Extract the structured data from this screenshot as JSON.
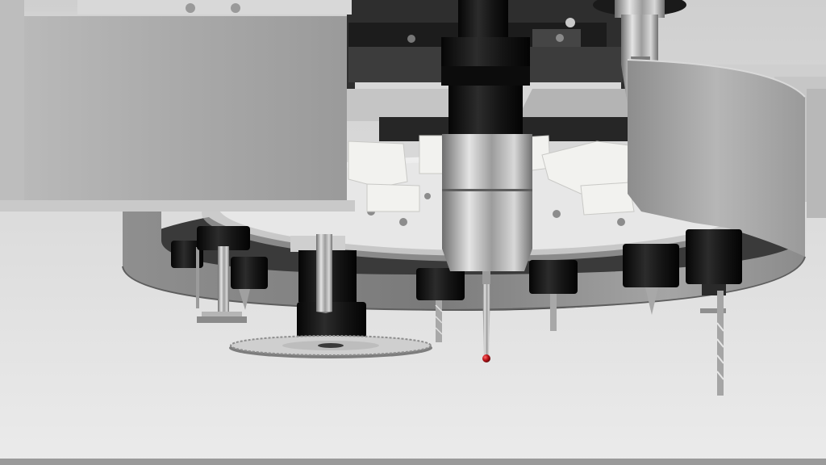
{
  "scene": {
    "subject": "cnc-rotary-tool-changer",
    "palette": {
      "backdrop_top": "#cfcfcf",
      "backdrop_bottom": "#ebebeb",
      "steel_light": "#bdbdbd",
      "steel_mid": "#8a8a8a",
      "steel_dark": "#3a3a3a",
      "holder_black": "#141414",
      "bracket_white": "#f2f2ef",
      "probe_ruby": "#c0161c"
    }
  }
}
